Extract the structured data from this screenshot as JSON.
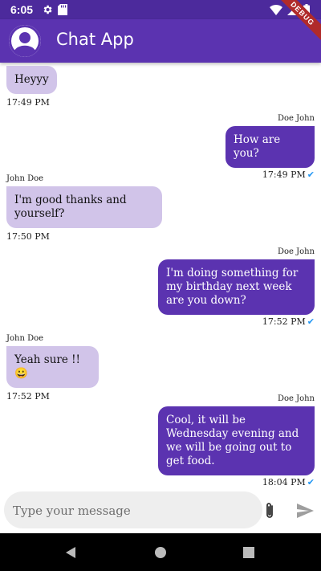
{
  "status_bar": {
    "time": "6:05"
  },
  "debug_label": "DEBUG",
  "app_bar": {
    "title": "Chat App"
  },
  "messages": [
    {
      "direction": "in",
      "text": "Heyyy",
      "time": "17:49 PM"
    },
    {
      "direction": "out",
      "sender": "Doe John",
      "text": "How are you?",
      "time": "17:49 PM"
    },
    {
      "direction": "in",
      "sender": "John Doe",
      "text": "I'm good thanks and yourself?",
      "time": "17:50 PM"
    },
    {
      "direction": "out",
      "sender": "Doe John",
      "text": "I'm doing something for my birthday next week are you down?",
      "time": "17:52 PM"
    },
    {
      "direction": "in",
      "sender": "John Doe",
      "text": "Yeah sure !!😀",
      "time": "17:52 PM"
    },
    {
      "direction": "out",
      "sender": "Doe John",
      "text": "Cool, it will be Wednesday evening and we will be going out to get food.",
      "time": "18:04 PM"
    }
  ],
  "composer": {
    "placeholder": "Type your message",
    "value": ""
  },
  "colors": {
    "primary": "#5b33b0",
    "status_bar": "#4c2a9c",
    "incoming_bubble": "#d1c4e9",
    "read_check": "#2196f3"
  },
  "icons": {
    "attach": "paperclip-icon",
    "send": "send-icon",
    "settings": "gear-icon",
    "sd_card": "sd-card-icon",
    "wifi": "wifi-icon",
    "battery": "battery-icon",
    "back": "back-icon",
    "home": "home-icon",
    "recents": "recents-icon"
  }
}
